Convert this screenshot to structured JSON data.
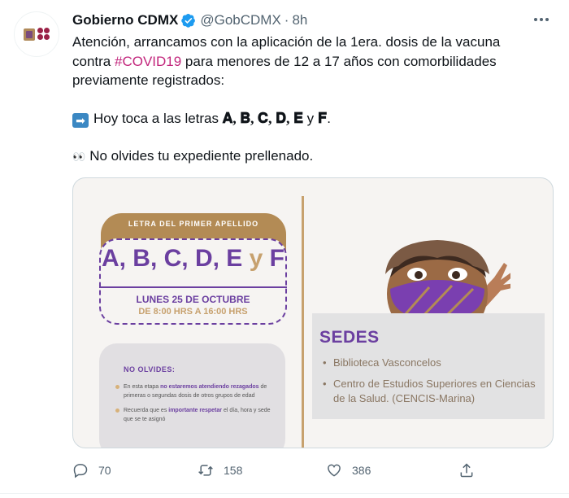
{
  "tweet": {
    "author_name": "Gobierno CDMX",
    "handle": "@GobCDMX",
    "separator": "·",
    "time": "8h",
    "text_line1": "Atención, arrancamos con la aplicación de la 1era. dosis de la vacuna",
    "text_line2_pre": "contra ",
    "hashtag": "#COVID19",
    "text_line2_post": " para menores de 12 a 17 años con comorbilidades",
    "text_line3": "previamente registrados:",
    "arrow_emoji": "➡",
    "today_pre": "Hoy toca a las letras ",
    "letters_serif": "𝐀, 𝐁, 𝐂, 𝐃, 𝐄",
    "letters_y": " y ",
    "letter_f": "𝐅",
    "today_end": ".",
    "eyes_emoji": "👀",
    "reminder": "No olvides tu expediente prellenado."
  },
  "media": {
    "banner": "LETRA DEL PRIMER APELLIDO",
    "letters_main": "A, B, C, D, E ",
    "letters_y": "y",
    "letters_f": " F",
    "date": "LUNES 25 DE OCTUBRE",
    "hours": "DE 8:00 HRS A 16:00 HRS",
    "note_title": "NO OLVIDES:",
    "note1_pre": "En esta etapa ",
    "note1_bold": "no estaremos atendiendo rezagados",
    "note1_post": " de primeras o segundas dosis de otros grupos de edad",
    "note2_pre": "Recuerda que es ",
    "note2_bold": "importante respetar",
    "note2_post": " el día, hora y sede que se te asignó",
    "sedes_title": "SEDES",
    "sede1": "Biblioteca Vasconcelos",
    "sede2": "Centro de Estudios Superiores en Ciencias de la Salud. (CENCIS-Marina)"
  },
  "actions": {
    "replies": "70",
    "retweets": "158",
    "likes": "386"
  },
  "colors": {
    "hashtag": "#c2267c",
    "purple": "#6b3fa0",
    "gold": "#b38b55",
    "verified": "#1d9bf0"
  },
  "icons": [
    "verified-badge-icon",
    "more-icon",
    "reply-icon",
    "retweet-icon",
    "like-icon",
    "share-icon"
  ]
}
